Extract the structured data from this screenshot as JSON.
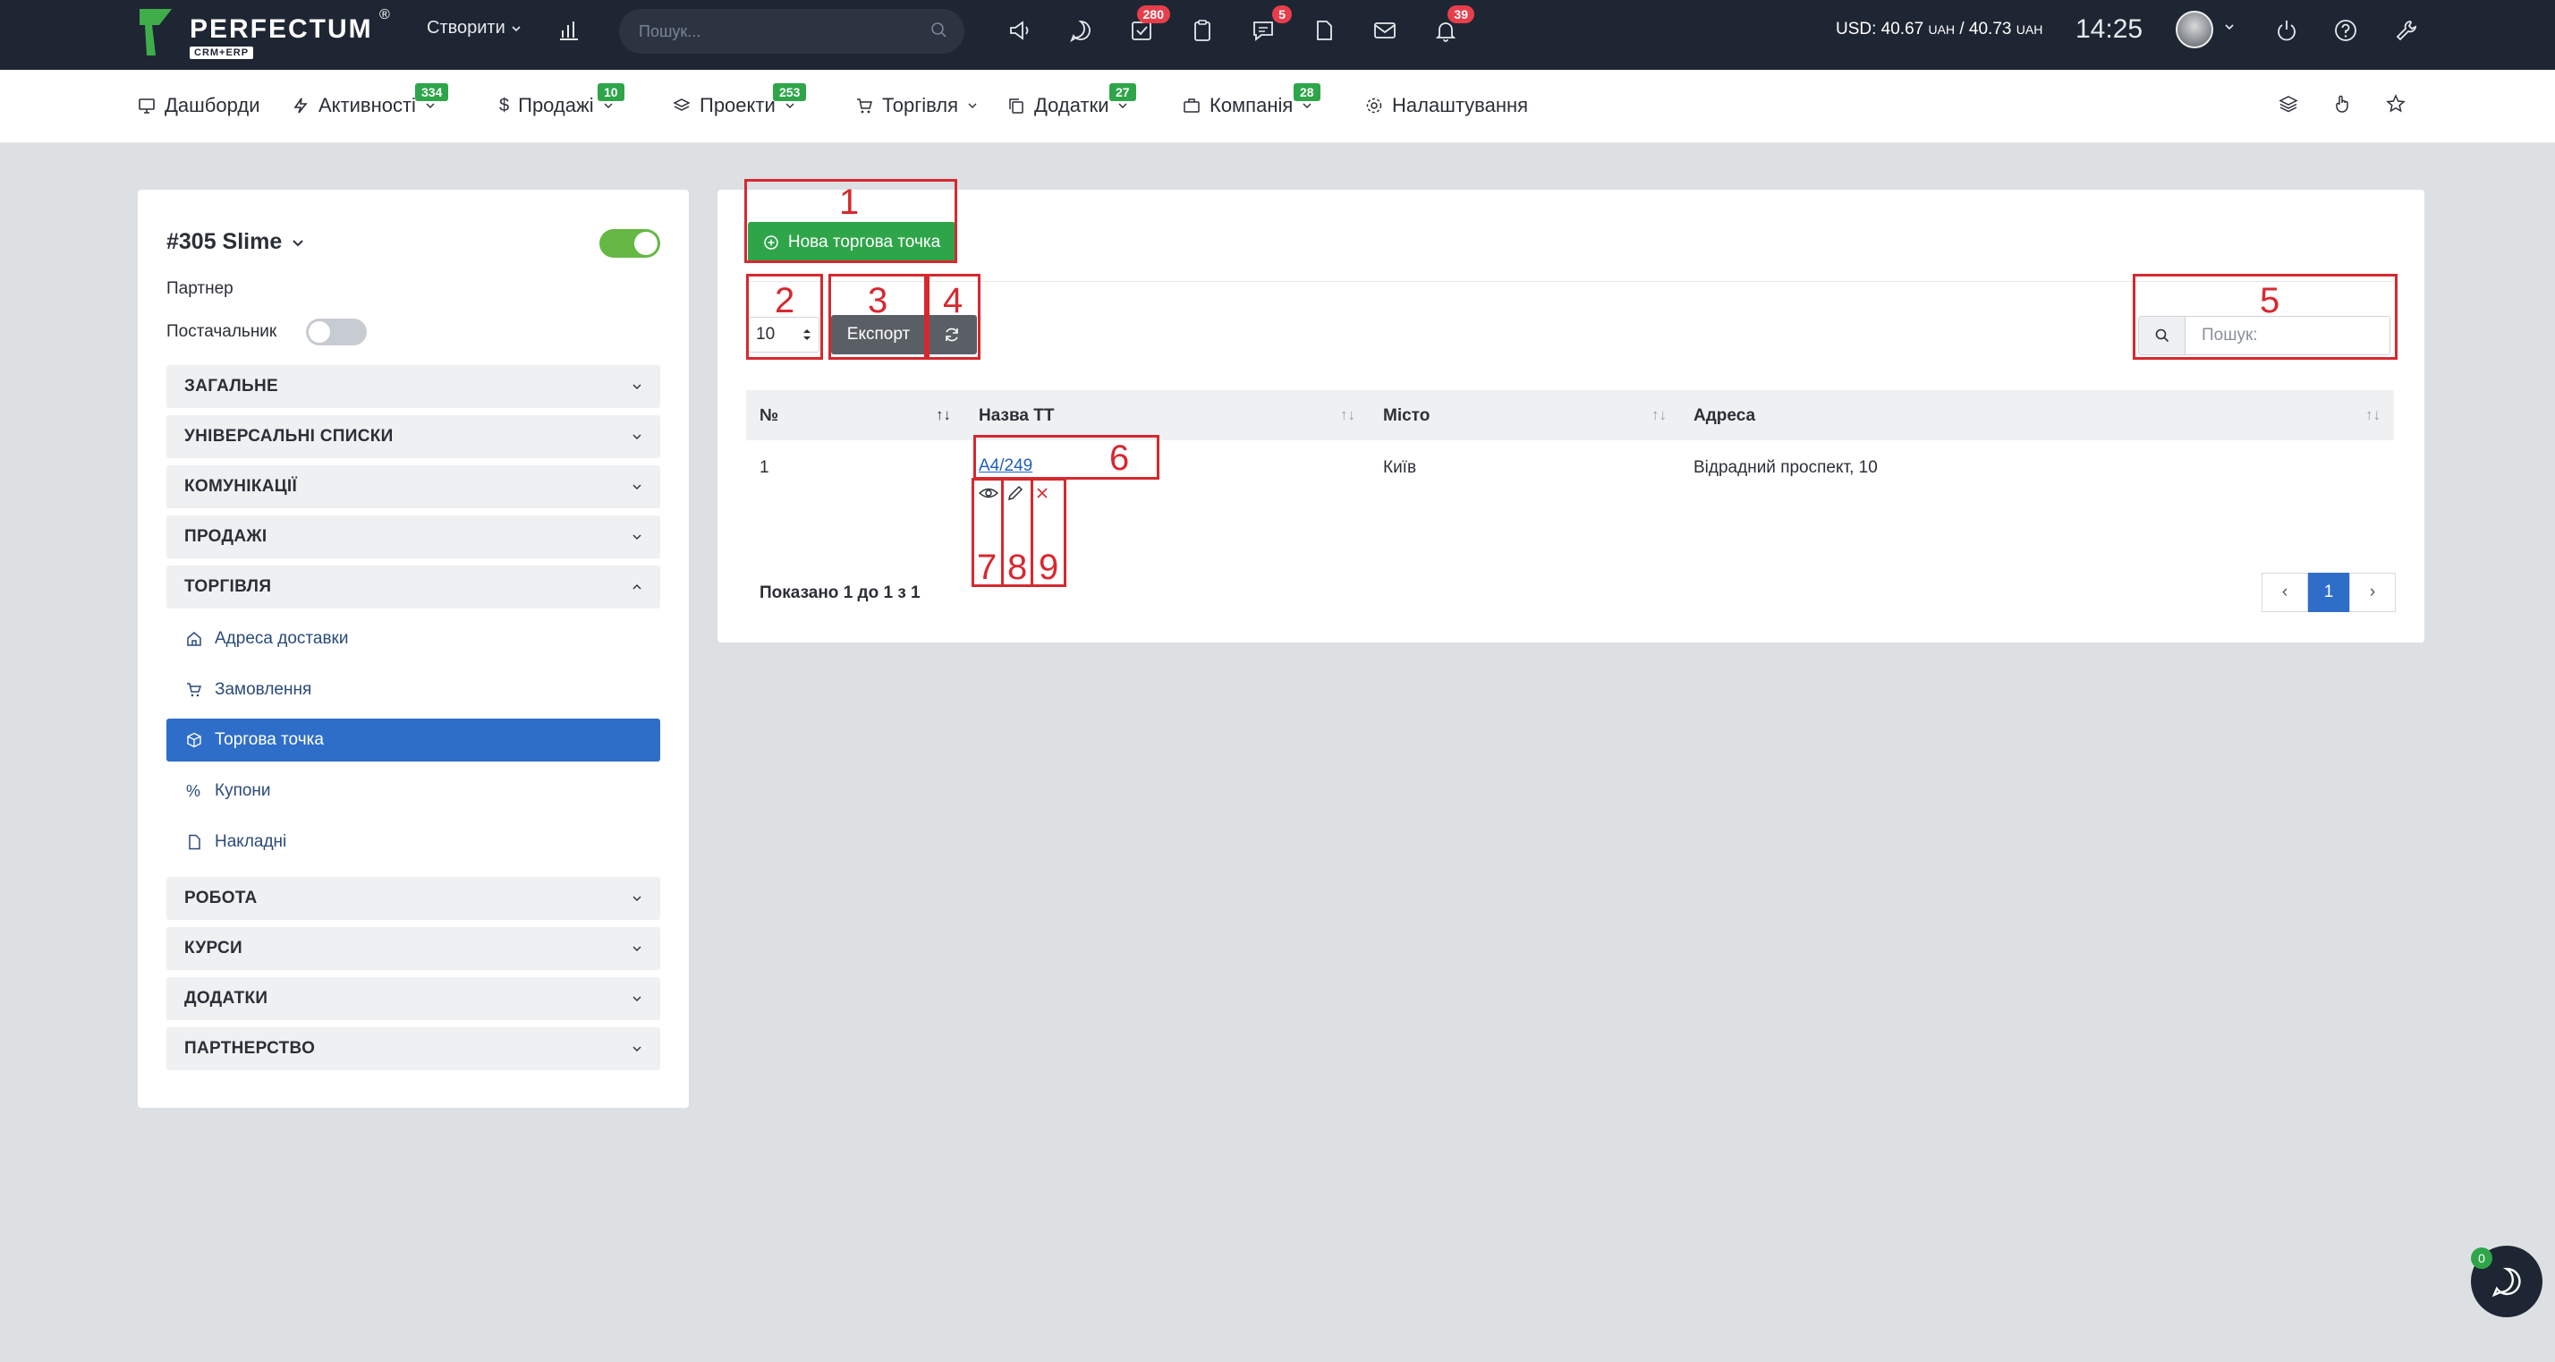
{
  "topbar": {
    "logo_text": "PERFECTUM",
    "logo_sub": "CRM+ERP",
    "logo_reg": "®",
    "create_label": "Створити",
    "search_placeholder": "Пошук...",
    "badges": {
      "tasks": "280",
      "messages": "5",
      "notifications": "39"
    },
    "currency_usd": "USD: 40.67",
    "currency_uah1": "UAH",
    "currency_sep": " / 40.73 ",
    "currency_uah2": "UAH",
    "clock": "14:25"
  },
  "nav": {
    "items": [
      {
        "label": "Дашборди",
        "badge": ""
      },
      {
        "label": "Активності",
        "badge": "334"
      },
      {
        "label": "Продажі",
        "badge": "10"
      },
      {
        "label": "Проекти",
        "badge": "253"
      },
      {
        "label": "Торгівля",
        "badge": ""
      },
      {
        "label": "Додатки",
        "badge": "27"
      },
      {
        "label": "Компанія",
        "badge": "28"
      },
      {
        "label": "Налаштування",
        "badge": ""
      }
    ]
  },
  "sidebar": {
    "client_title": "#305 Slime",
    "partner_label": "Партнер",
    "supplier_label": "Постачальник",
    "sections": [
      "ЗАГАЛЬНЕ",
      "УНІВЕРСАЛЬНІ СПИСКИ",
      "КОМУНІКАЦІЇ",
      "ПРОДАЖІ",
      "ТОРГІВЛЯ",
      "РОБОТА",
      "КУРСИ",
      "ДОДАТКИ",
      "ПАРТНЕРСТВО"
    ],
    "trade_items": [
      "Адреса доставки",
      "Замовлення",
      "Торгова точка",
      "Купони",
      "Накладні"
    ],
    "active_item": "Торгова точка"
  },
  "main": {
    "new_button": "Нова торгова точка",
    "page_length": "10",
    "export_button": "Експорт",
    "search_placeholder": "Пошук:",
    "columns": [
      "№",
      "Назва ТТ",
      "Місто",
      "Адреса"
    ],
    "rows": [
      {
        "num": "1",
        "name": "А4/249",
        "city": "Київ",
        "address": "Відрадний проспект, 10"
      }
    ],
    "info": "Показано 1 до 1 з 1",
    "pager": {
      "prev": "‹",
      "current": "1",
      "next": "›"
    }
  },
  "annotations": [
    "1",
    "2",
    "3",
    "4",
    "5",
    "6",
    "7",
    "8",
    "9"
  ],
  "chat_badge": "0",
  "colors": {
    "accent": "#2f6ec8",
    "success": "#2fa54a",
    "danger": "#e83e4c",
    "annotation": "#d7282f",
    "topbar": "#1f2633"
  }
}
